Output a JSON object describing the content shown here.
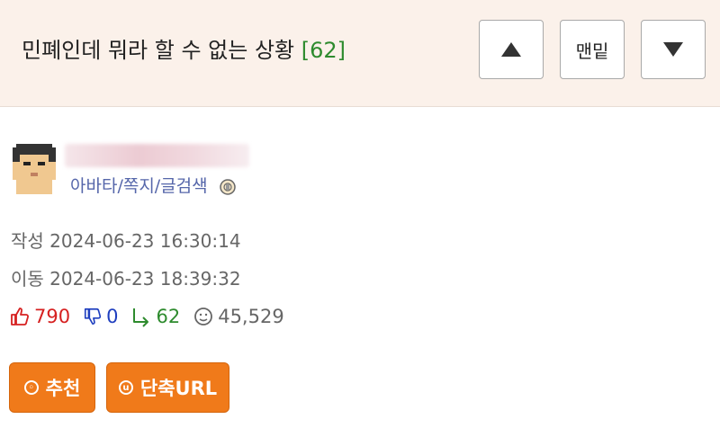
{
  "post": {
    "title": "민폐인데 뭐라 할 수 없는 상황",
    "comment_count": "[62]"
  },
  "nav": {
    "up_icon": "triangle-up-icon",
    "bottom_label": "맨밑",
    "down_icon": "triangle-down-icon"
  },
  "author": {
    "links": "아바타/쪽지/글검색"
  },
  "meta": {
    "written": "작성 2024-06-23 16:30:14",
    "moved": "이동 2024-06-23 18:39:32"
  },
  "stats": {
    "upvotes": "790",
    "downvotes": "0",
    "replies": "62",
    "views": "45,529"
  },
  "actions": {
    "recommend_label": "추천",
    "shorturl_label": "단축URL"
  },
  "colors": {
    "header_bg": "#fbf1ea",
    "accent_orange": "#f07a1a",
    "upvote_red": "#d62020",
    "downvote_blue": "#1f3fbf",
    "reply_green": "#2e8b2e",
    "link_blue": "#5566aa"
  }
}
